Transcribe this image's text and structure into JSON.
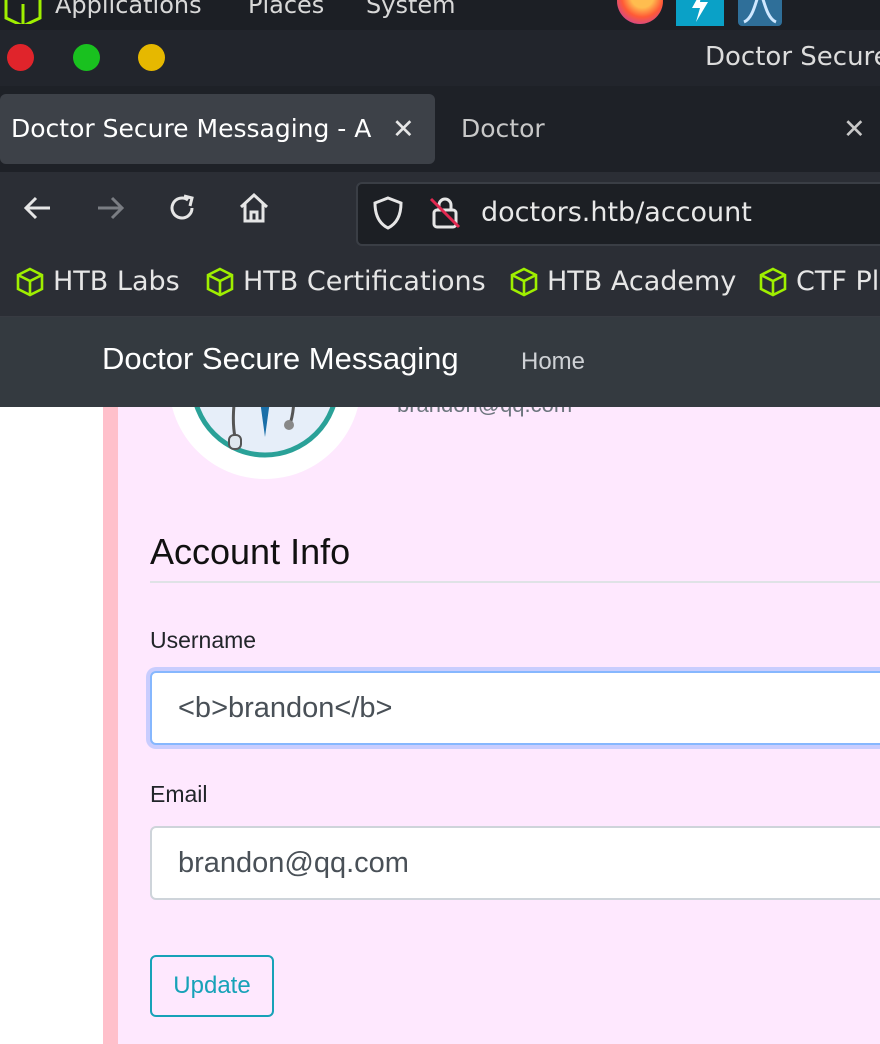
{
  "desktop_panel": {
    "menus": [
      "Applications",
      "Places",
      "System"
    ],
    "launchers": [
      "firefox-icon",
      "burpsuite-icon",
      "wireshark-icon"
    ]
  },
  "window": {
    "title": "Doctor Secure",
    "controls": {
      "close_color": "#e0242b",
      "maximize_color": "#19c11f",
      "minimize_color": "#e6b800"
    }
  },
  "tabs": [
    {
      "label": "Doctor Secure Messaging - A",
      "active": true
    },
    {
      "label": "Doctor",
      "active": false
    }
  ],
  "navbar": {
    "url": "doctors.htb/account"
  },
  "bookmarks": [
    {
      "label": "HTB Labs"
    },
    {
      "label": "HTB Certifications"
    },
    {
      "label": "HTB Academy"
    },
    {
      "label": "CTF Pl"
    }
  ],
  "site": {
    "brand": "Doctor Secure Messaging",
    "nav_home": "Home"
  },
  "account": {
    "email_header": "brandon@qq.com",
    "section_title": "Account Info",
    "username_label": "Username",
    "username_value": "<b>brandon</b>",
    "email_label": "Email",
    "email_value": "brandon@qq.com",
    "update_button": "Update"
  },
  "colors": {
    "card_bg": "#fee8fe",
    "card_border": "#ffc0cb",
    "accent": "#17a2b8",
    "bookmark_icon": "#9fef00"
  }
}
